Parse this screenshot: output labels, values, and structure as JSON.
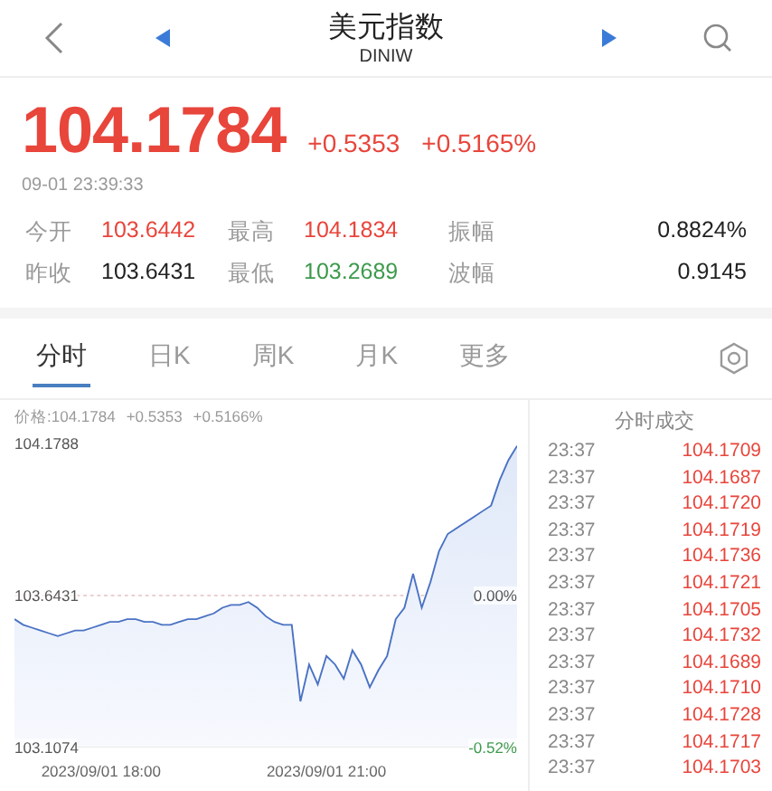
{
  "header": {
    "title": "美元指数",
    "code": "DINIW"
  },
  "quote": {
    "price": "104.1784",
    "change": "+0.5353",
    "change_pct": "+0.5165%",
    "time": "09-01 23:39:33"
  },
  "stats": [
    {
      "label": "今开",
      "value": "103.6442",
      "color": "#e8453b"
    },
    {
      "label": "最高",
      "value": "104.1834",
      "color": "#e8453b"
    },
    {
      "label": "振幅",
      "value": "0.8824%",
      "color": "#222222"
    },
    {
      "label": "昨收",
      "value": "103.6431",
      "color": "#222222"
    },
    {
      "label": "最低",
      "value": "103.2689",
      "color": "#3d9a4c"
    },
    {
      "label": "波幅",
      "value": "0.9145",
      "color": "#222222"
    }
  ],
  "tabs": [
    {
      "label": "分时",
      "selected": true
    },
    {
      "label": "日K",
      "selected": false
    },
    {
      "label": "周K",
      "selected": false
    },
    {
      "label": "月K",
      "selected": false
    },
    {
      "label": "更多",
      "selected": false
    }
  ],
  "chart": {
    "info": [
      "价格:104.1784",
      "+0.5353",
      "+0.5166%"
    ],
    "right_labels": [
      "0.00%",
      "-0.52%"
    ],
    "chart_data": {
      "type": "area",
      "categories": [
        null,
        null,
        null,
        null,
        null,
        null,
        null,
        null,
        null,
        null,
        "2023/09/01 18:00",
        null,
        null,
        null,
        null,
        null,
        null,
        null,
        null,
        null,
        null,
        null,
        null,
        null,
        null,
        null,
        null,
        null,
        null,
        null,
        null,
        null,
        null,
        null,
        null,
        null,
        "2023/09/01 21:00",
        null,
        null,
        null,
        null,
        null,
        null,
        null,
        null,
        null,
        null,
        null,
        null,
        null,
        null,
        null,
        null,
        null,
        null,
        null,
        null,
        null,
        null
      ],
      "series": [
        {
          "color": "#4a72c4",
          "values": [
            103.56,
            103.54,
            103.53,
            103.52,
            103.51,
            103.5,
            103.51,
            103.52,
            103.52,
            103.53,
            103.54,
            103.55,
            103.55,
            103.56,
            103.56,
            103.55,
            103.55,
            103.54,
            103.54,
            103.55,
            103.56,
            103.56,
            103.57,
            103.58,
            103.6,
            103.61,
            103.61,
            103.62,
            103.6,
            103.57,
            103.55,
            103.54,
            103.54,
            103.27,
            103.4,
            103.33,
            103.43,
            103.4,
            103.35,
            103.45,
            103.4,
            103.32,
            103.38,
            103.43,
            103.56,
            103.6,
            103.72,
            103.6,
            103.69,
            103.8,
            103.86,
            103.88,
            103.9,
            103.92,
            103.94,
            103.96,
            104.05,
            104.12,
            104.17
          ]
        }
      ],
      "ref_lines": [
        {
          "axis": "y",
          "value": 103.6431
        }
      ],
      "ylim": [
        103.1074,
        104.1788
      ],
      "yticks": [
        {
          "value": 104.1788,
          "label": "104.1788"
        },
        {
          "value": 103.6431,
          "label": "103.6431"
        },
        {
          "value": 103.1074,
          "label": "103.1074"
        }
      ]
    }
  },
  "trades": {
    "title": "分时成交",
    "rows": [
      {
        "time": "23:37",
        "price": "104.1709"
      },
      {
        "time": "23:37",
        "price": "104.1687"
      },
      {
        "time": "23:37",
        "price": "104.1720"
      },
      {
        "time": "23:37",
        "price": "104.1719"
      },
      {
        "time": "23:37",
        "price": "104.1736"
      },
      {
        "time": "23:37",
        "price": "104.1721"
      },
      {
        "time": "23:37",
        "price": "104.1705"
      },
      {
        "time": "23:37",
        "price": "104.1732"
      },
      {
        "time": "23:37",
        "price": "104.1689"
      },
      {
        "time": "23:37",
        "price": "104.1710"
      },
      {
        "time": "23:37",
        "price": "104.1728"
      },
      {
        "time": "23:37",
        "price": "104.1717"
      },
      {
        "time": "23:37",
        "price": "104.1703"
      }
    ]
  }
}
